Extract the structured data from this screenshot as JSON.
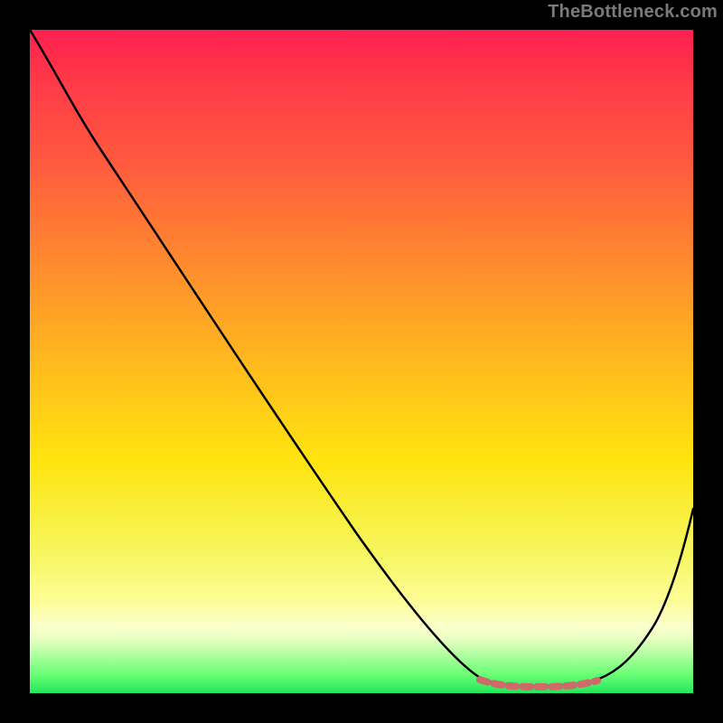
{
  "watermark": {
    "text": "TheBottleneck.com"
  },
  "chart_data": {
    "type": "line",
    "title": "",
    "xlabel": "",
    "ylabel": "",
    "x": [
      0,
      0.03,
      0.11,
      0.24,
      0.37,
      0.5,
      0.6,
      0.69,
      0.72,
      0.76,
      0.8,
      0.85,
      0.9,
      1.0
    ],
    "series": [
      {
        "name": "curve",
        "values": [
          1.0,
          0.95,
          0.82,
          0.62,
          0.42,
          0.23,
          0.1,
          0.015,
          0.01,
          0.01,
          0.012,
          0.02,
          0.08,
          0.28
        ]
      }
    ],
    "highlight_segment": {
      "x_start": 0.69,
      "x_end": 0.85,
      "approx_value": 0.012,
      "color": "#d46666"
    },
    "ylim": [
      0,
      1
    ],
    "xlim": [
      0,
      1
    ],
    "background_gradient": {
      "stops": [
        {
          "pos": 0.0,
          "color": "#ff1f4f"
        },
        {
          "pos": 0.2,
          "color": "#ff5a3e"
        },
        {
          "pos": 0.5,
          "color": "#ffb91e"
        },
        {
          "pos": 0.78,
          "color": "#f6f55a"
        },
        {
          "pos": 0.92,
          "color": "#e4ffc0"
        },
        {
          "pos": 1.0,
          "color": "#22e75a"
        }
      ]
    }
  }
}
